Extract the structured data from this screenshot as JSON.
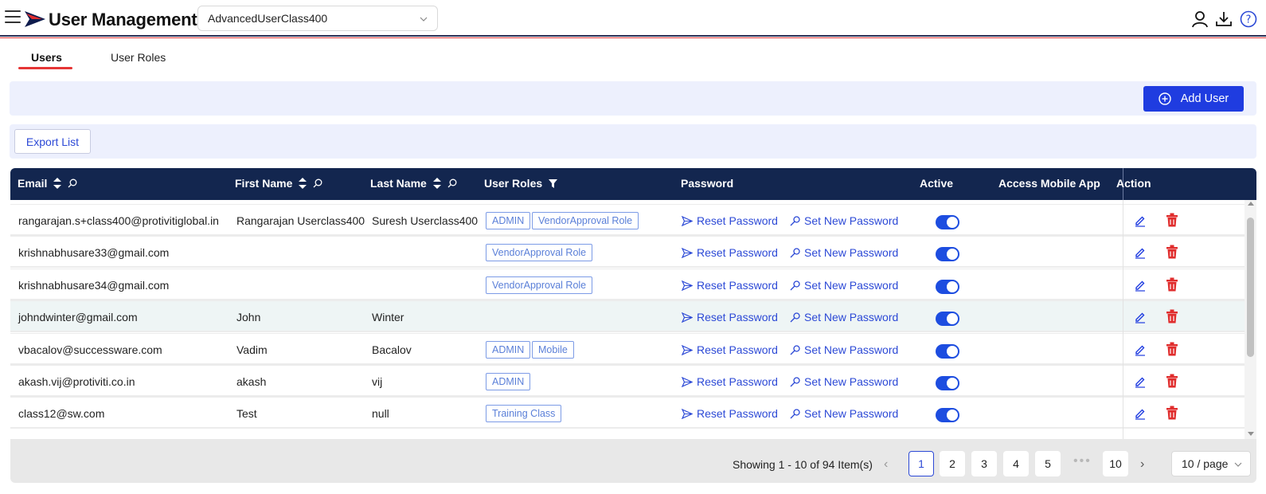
{
  "header": {
    "title": "User Management",
    "class_select": "AdvancedUserClass400"
  },
  "tabs": [
    {
      "label": "Users",
      "active": true
    },
    {
      "label": "User Roles",
      "active": false
    }
  ],
  "toolbar": {
    "add_user_label": "Add User",
    "export_label": "Export List"
  },
  "table": {
    "columns": [
      "Email",
      "First Name",
      "Last Name",
      "User Roles",
      "Password",
      "Active",
      "Access Mobile App",
      "Action"
    ],
    "reset_label": "Reset Password",
    "set_label": "Set New Password",
    "rows": [
      {
        "email": "rangarajan.s+class400@protivitiglobal.in",
        "first": "Rangarajan Userclass400",
        "last": "Suresh Userclass400",
        "roles": [
          "ADMIN",
          "VendorApproval Role"
        ],
        "active": true
      },
      {
        "email": "krishnabhusare33@gmail.com",
        "first": "",
        "last": "",
        "roles": [
          "VendorApproval Role"
        ],
        "active": true
      },
      {
        "email": "krishnabhusare34@gmail.com",
        "first": "",
        "last": "",
        "roles": [
          "VendorApproval Role"
        ],
        "active": true
      },
      {
        "email": "johndwinter@gmail.com",
        "first": "John",
        "last": "Winter",
        "roles": [],
        "active": true
      },
      {
        "email": "vbacalov@successware.com",
        "first": "Vadim",
        "last": "Bacalov",
        "roles": [
          "ADMIN",
          "Mobile"
        ],
        "active": true
      },
      {
        "email": "akash.vij@protiviti.co.in",
        "first": "akash",
        "last": "vij",
        "roles": [
          "ADMIN"
        ],
        "active": true
      },
      {
        "email": "class12@sw.com",
        "first": "Test",
        "last": "null",
        "roles": [
          "Training Class"
        ],
        "active": true
      }
    ]
  },
  "pagination": {
    "showing": "Showing 1 - 10 of 94 Item(s)",
    "pages": [
      "1",
      "2",
      "3",
      "4",
      "5"
    ],
    "last_page": "10",
    "current": "1",
    "page_size": "10 / page"
  },
  "colors": {
    "header_bg": "#13264f",
    "accent": "#1f3ce0",
    "danger": "#e02d2d",
    "tab_underline": "#e53535"
  }
}
